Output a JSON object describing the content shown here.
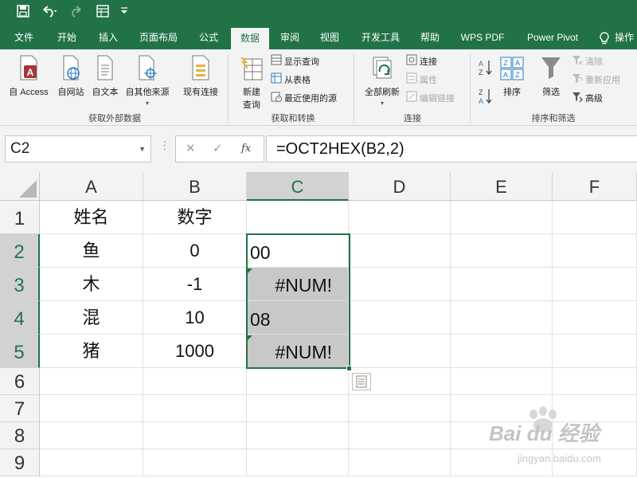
{
  "qat": {
    "save_icon": "save-icon",
    "undo_icon": "undo-icon",
    "redo_icon": "redo-icon",
    "form_icon": "form-icon",
    "customize_icon": "customize-icon"
  },
  "tabs": [
    {
      "label": "文件"
    },
    {
      "label": "开始"
    },
    {
      "label": "插入"
    },
    {
      "label": "页面布局"
    },
    {
      "label": "公式"
    },
    {
      "label": "数据",
      "active": true
    },
    {
      "label": "审阅"
    },
    {
      "label": "视图"
    },
    {
      "label": "开发工具"
    },
    {
      "label": "帮助"
    },
    {
      "label": "WPS PDF"
    },
    {
      "label": "Power Pivot"
    },
    {
      "label": "操作"
    }
  ],
  "ribbon": {
    "get_external": {
      "from_access": "自 Access",
      "from_web": "自网站",
      "from_text": "自文本",
      "from_other": "自其他来源",
      "existing": "现有连接",
      "group_label": "获取外部数据"
    },
    "get_transform": {
      "new_query": "新建\n查询",
      "new_query_line1": "新建",
      "new_query_line2": "查询",
      "show_queries": "显示查询",
      "from_table": "从表格",
      "recent_sources": "最近使用的源",
      "group_label": "获取和转换"
    },
    "connections": {
      "refresh_all": "全部刷新",
      "connections": "连接",
      "properties": "属性",
      "edit_links": "编辑链接",
      "group_label": "连接"
    },
    "sort_filter": {
      "sort": "排序",
      "filter": "筛选",
      "clear": "清除",
      "reapply": "重新应用",
      "advanced": "高级",
      "group_label": "排序和筛选"
    }
  },
  "formula_bar": {
    "name_box": "C2",
    "cancel_icon": "✕",
    "enter_icon": "✓",
    "fx_label": "fx",
    "formula": "=OCT2HEX(B2,2)"
  },
  "sheet": {
    "columns": [
      "A",
      "B",
      "C",
      "D",
      "E",
      "F"
    ],
    "rows": [
      "1",
      "2",
      "3",
      "4",
      "5",
      "6",
      "7",
      "8",
      "9"
    ],
    "selected_cell": "C2",
    "cells": {
      "A1": "姓名",
      "B1": "数字",
      "A2": "鱼",
      "B2": "0",
      "C2": "00",
      "A3": "木",
      "B3": "-1",
      "C3": "#NUM!",
      "A4": "混",
      "B4": "10",
      "C4": "08",
      "A5": "猪",
      "B5": "1000",
      "C5": "#NUM!"
    }
  },
  "watermark": {
    "brand": "Bai du 经验",
    "url": "jingyan.baidu.com"
  },
  "colors": {
    "accent": "#217346",
    "ribbon_bg": "#f3f3f3",
    "selection_fill": "#c8c8c8"
  }
}
